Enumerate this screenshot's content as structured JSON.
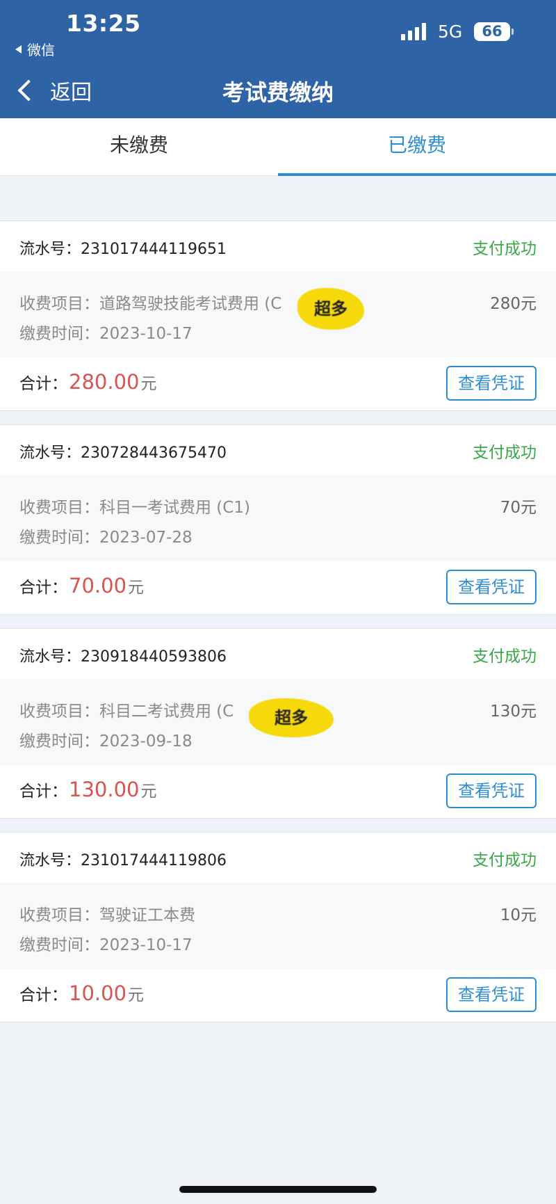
{
  "status_bar": {
    "time": "13:25",
    "back_app": "微信",
    "network": "5G",
    "battery": "66"
  },
  "nav": {
    "back_label": "返回",
    "title": "考试费缴纳"
  },
  "tabs": [
    {
      "label": "未缴费",
      "active": false
    },
    {
      "label": "已缴费",
      "active": true
    }
  ],
  "labels": {
    "serial": "流水号：",
    "item": "收费项目：",
    "date": "缴费时间：",
    "total": "合计：",
    "unit": "元",
    "voucher": "查看凭证"
  },
  "records": [
    {
      "serial": "231017444119651",
      "status": "支付成功",
      "item": "道路驾驶技能考试费用 (C",
      "amount": "280元",
      "date": "2023-10-17",
      "total": "280.00"
    },
    {
      "serial": "230728443675470",
      "status": "支付成功",
      "item": "科目一考试费用 (C1)",
      "amount": "70元",
      "date": "2023-07-28",
      "total": "70.00"
    },
    {
      "serial": "230918440593806",
      "status": "支付成功",
      "item": "科目二考试费用 (C",
      "amount": "130元",
      "date": "2023-09-18",
      "total": "130.00"
    },
    {
      "serial": "231017444119806",
      "status": "支付成功",
      "item": "驾驶证工本费",
      "amount": "10元",
      "date": "2023-10-17",
      "total": "10.00"
    }
  ],
  "stickers": [
    "超多",
    "超多"
  ],
  "colors": {
    "header": "#2e63a6",
    "accent": "#2f8ed2",
    "success": "#3aa84a",
    "price": "#d9534f"
  }
}
